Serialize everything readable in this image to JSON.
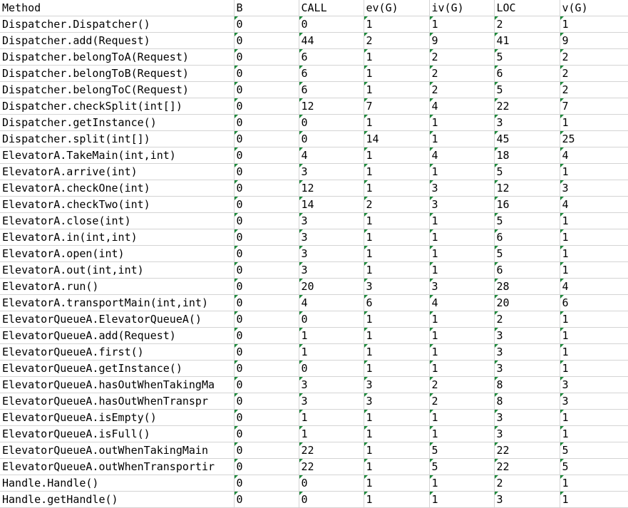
{
  "columns": [
    "Method",
    "B",
    "CALL",
    "ev(G)",
    "iv(G)",
    "LOC",
    "v(G)"
  ],
  "rows": [
    [
      "Dispatcher.Dispatcher()",
      "0",
      "0",
      "1",
      "1",
      "2",
      "1"
    ],
    [
      "Dispatcher.add(Request)",
      "0",
      "44",
      "2",
      "9",
      "41",
      "9"
    ],
    [
      "Dispatcher.belongToA(Request)",
      "0",
      "6",
      "1",
      "2",
      "5",
      "2"
    ],
    [
      "Dispatcher.belongToB(Request)",
      "0",
      "6",
      "1",
      "2",
      "6",
      "2"
    ],
    [
      "Dispatcher.belongToC(Request)",
      "0",
      "6",
      "1",
      "2",
      "5",
      "2"
    ],
    [
      "Dispatcher.checkSplit(int[])",
      "0",
      "12",
      "7",
      "4",
      "22",
      "7"
    ],
    [
      "Dispatcher.getInstance()",
      "0",
      "0",
      "1",
      "1",
      "3",
      "1"
    ],
    [
      "Dispatcher.split(int[])",
      "0",
      "0",
      "14",
      "1",
      "45",
      "25"
    ],
    [
      "ElevatorA.TakeMain(int,int)",
      "0",
      "4",
      "1",
      "4",
      "18",
      "4"
    ],
    [
      "ElevatorA.arrive(int)",
      "0",
      "3",
      "1",
      "1",
      "5",
      "1"
    ],
    [
      "ElevatorA.checkOne(int)",
      "0",
      "12",
      "1",
      "3",
      "12",
      "3"
    ],
    [
      "ElevatorA.checkTwo(int)",
      "0",
      "14",
      "2",
      "3",
      "16",
      "4"
    ],
    [
      "ElevatorA.close(int)",
      "0",
      "3",
      "1",
      "1",
      "5",
      "1"
    ],
    [
      "ElevatorA.in(int,int)",
      "0",
      "3",
      "1",
      "1",
      "6",
      "1"
    ],
    [
      "ElevatorA.open(int)",
      "0",
      "3",
      "1",
      "1",
      "5",
      "1"
    ],
    [
      "ElevatorA.out(int,int)",
      "0",
      "3",
      "1",
      "1",
      "6",
      "1"
    ],
    [
      "ElevatorA.run()",
      "0",
      "20",
      "3",
      "3",
      "28",
      "4"
    ],
    [
      "ElevatorA.transportMain(int,int)",
      "0",
      "4",
      "6",
      "4",
      "20",
      "6"
    ],
    [
      "ElevatorQueueA.ElevatorQueueA()",
      "0",
      "0",
      "1",
      "1",
      "2",
      "1"
    ],
    [
      "ElevatorQueueA.add(Request)",
      "0",
      "1",
      "1",
      "1",
      "3",
      "1"
    ],
    [
      "ElevatorQueueA.first()",
      "0",
      "1",
      "1",
      "1",
      "3",
      "1"
    ],
    [
      "ElevatorQueueA.getInstance()",
      "0",
      "0",
      "1",
      "1",
      "3",
      "1"
    ],
    [
      "ElevatorQueueA.hasOutWhenTakingMa",
      "0",
      "3",
      "3",
      "2",
      "8",
      "3"
    ],
    [
      "ElevatorQueueA.hasOutWhenTranspr",
      "0",
      "3",
      "3",
      "2",
      "8",
      "3"
    ],
    [
      "ElevatorQueueA.isEmpty()",
      "0",
      "1",
      "1",
      "1",
      "3",
      "1"
    ],
    [
      "ElevatorQueueA.isFull()",
      "0",
      "1",
      "1",
      "1",
      "3",
      "1"
    ],
    [
      "ElevatorQueueA.outWhenTakingMain",
      "0",
      "22",
      "1",
      "5",
      "22",
      "5"
    ],
    [
      "ElevatorQueueA.outWhenTransportir",
      "0",
      "22",
      "1",
      "5",
      "22",
      "5"
    ],
    [
      "Handle.Handle()",
      "0",
      "0",
      "1",
      "1",
      "2",
      "1"
    ],
    [
      "Handle.getHandle()",
      "0",
      "0",
      "1",
      "1",
      "3",
      "1"
    ]
  ],
  "colors": {
    "gridline": "#d4d4d4",
    "number_stored_as_text_marker": "#1e8a3c"
  },
  "icons": {
    "cell_marker": "number-stored-as-text-indicator-icon"
  }
}
